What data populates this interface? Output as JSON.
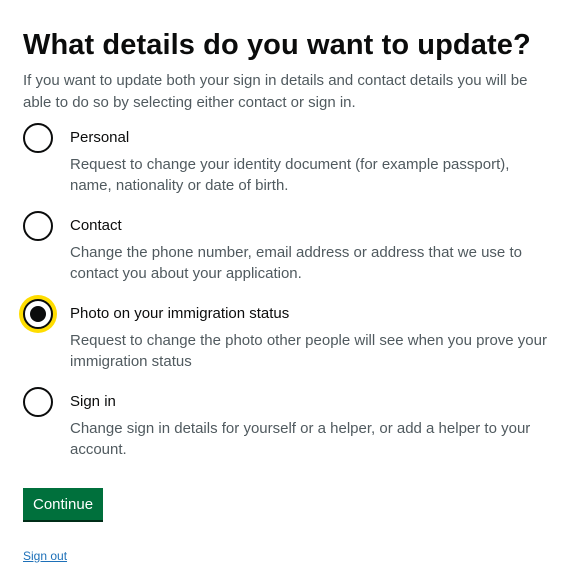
{
  "page": {
    "title": "What details do you want to update?",
    "hint": "If you want to update both your sign in details and contact details you will be able to do so by selecting either contact or sign in."
  },
  "options": [
    {
      "label": "Personal",
      "hint": "Request to change your identity document (for example passport), name, nationality or date of birth.",
      "selected": false
    },
    {
      "label": "Contact",
      "hint": "Change the phone number, email address or address that we use to contact you about your application.",
      "selected": false
    },
    {
      "label": "Photo on your immigration status",
      "hint": "Request to change the photo other people will see when you prove your immigration status",
      "selected": true
    },
    {
      "label": "Sign in",
      "hint": "Change sign in details for yourself or a helper, or add a helper to your account.",
      "selected": false
    }
  ],
  "actions": {
    "continue_label": "Continue",
    "sign_out_label": "Sign out"
  },
  "colors": {
    "button_green": "#00703c",
    "focus_yellow": "#ffdd00",
    "link_blue": "#1d70b8",
    "text": "#0b0c0c",
    "hint_text": "#505a5f"
  }
}
